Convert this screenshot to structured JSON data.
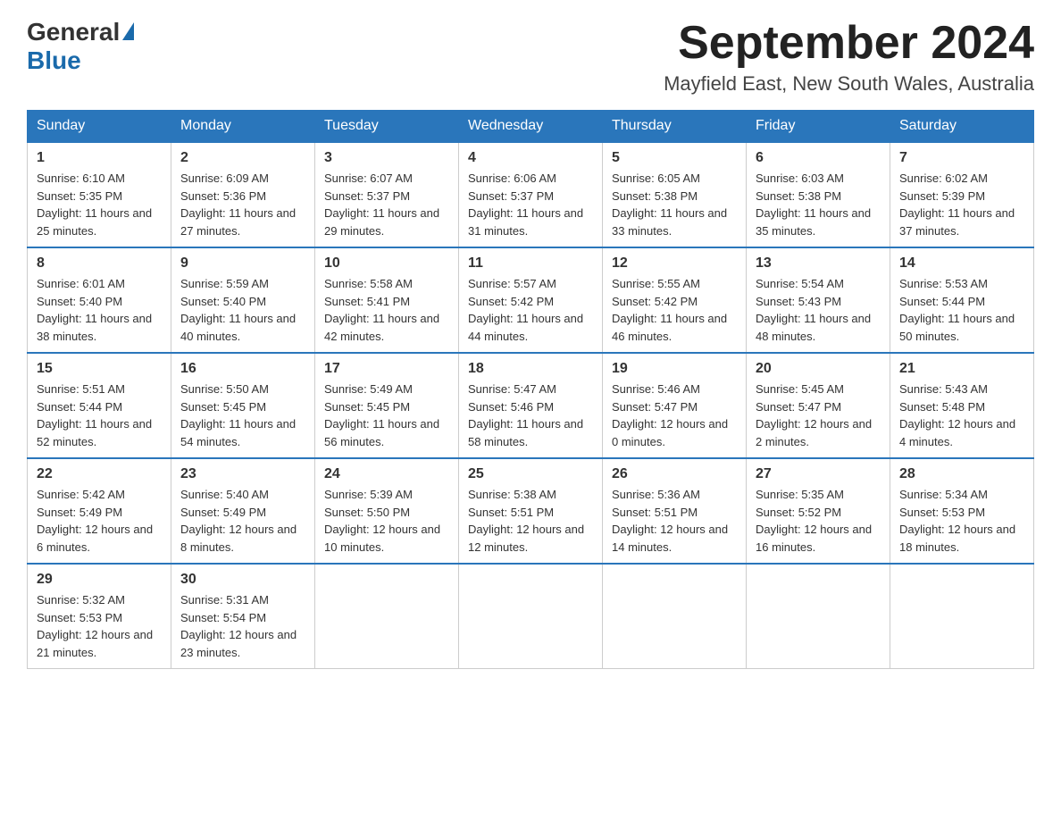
{
  "logo": {
    "text_general": "General",
    "triangle": "▲",
    "text_blue": "Blue"
  },
  "header": {
    "month_title": "September 2024",
    "location": "Mayfield East, New South Wales, Australia"
  },
  "days_of_week": [
    "Sunday",
    "Monday",
    "Tuesday",
    "Wednesday",
    "Thursday",
    "Friday",
    "Saturday"
  ],
  "weeks": [
    [
      {
        "day": "1",
        "sunrise": "6:10 AM",
        "sunset": "5:35 PM",
        "daylight": "11 hours and 25 minutes."
      },
      {
        "day": "2",
        "sunrise": "6:09 AM",
        "sunset": "5:36 PM",
        "daylight": "11 hours and 27 minutes."
      },
      {
        "day": "3",
        "sunrise": "6:07 AM",
        "sunset": "5:37 PM",
        "daylight": "11 hours and 29 minutes."
      },
      {
        "day": "4",
        "sunrise": "6:06 AM",
        "sunset": "5:37 PM",
        "daylight": "11 hours and 31 minutes."
      },
      {
        "day": "5",
        "sunrise": "6:05 AM",
        "sunset": "5:38 PM",
        "daylight": "11 hours and 33 minutes."
      },
      {
        "day": "6",
        "sunrise": "6:03 AM",
        "sunset": "5:38 PM",
        "daylight": "11 hours and 35 minutes."
      },
      {
        "day": "7",
        "sunrise": "6:02 AM",
        "sunset": "5:39 PM",
        "daylight": "11 hours and 37 minutes."
      }
    ],
    [
      {
        "day": "8",
        "sunrise": "6:01 AM",
        "sunset": "5:40 PM",
        "daylight": "11 hours and 38 minutes."
      },
      {
        "day": "9",
        "sunrise": "5:59 AM",
        "sunset": "5:40 PM",
        "daylight": "11 hours and 40 minutes."
      },
      {
        "day": "10",
        "sunrise": "5:58 AM",
        "sunset": "5:41 PM",
        "daylight": "11 hours and 42 minutes."
      },
      {
        "day": "11",
        "sunrise": "5:57 AM",
        "sunset": "5:42 PM",
        "daylight": "11 hours and 44 minutes."
      },
      {
        "day": "12",
        "sunrise": "5:55 AM",
        "sunset": "5:42 PM",
        "daylight": "11 hours and 46 minutes."
      },
      {
        "day": "13",
        "sunrise": "5:54 AM",
        "sunset": "5:43 PM",
        "daylight": "11 hours and 48 minutes."
      },
      {
        "day": "14",
        "sunrise": "5:53 AM",
        "sunset": "5:44 PM",
        "daylight": "11 hours and 50 minutes."
      }
    ],
    [
      {
        "day": "15",
        "sunrise": "5:51 AM",
        "sunset": "5:44 PM",
        "daylight": "11 hours and 52 minutes."
      },
      {
        "day": "16",
        "sunrise": "5:50 AM",
        "sunset": "5:45 PM",
        "daylight": "11 hours and 54 minutes."
      },
      {
        "day": "17",
        "sunrise": "5:49 AM",
        "sunset": "5:45 PM",
        "daylight": "11 hours and 56 minutes."
      },
      {
        "day": "18",
        "sunrise": "5:47 AM",
        "sunset": "5:46 PM",
        "daylight": "11 hours and 58 minutes."
      },
      {
        "day": "19",
        "sunrise": "5:46 AM",
        "sunset": "5:47 PM",
        "daylight": "12 hours and 0 minutes."
      },
      {
        "day": "20",
        "sunrise": "5:45 AM",
        "sunset": "5:47 PM",
        "daylight": "12 hours and 2 minutes."
      },
      {
        "day": "21",
        "sunrise": "5:43 AM",
        "sunset": "5:48 PM",
        "daylight": "12 hours and 4 minutes."
      }
    ],
    [
      {
        "day": "22",
        "sunrise": "5:42 AM",
        "sunset": "5:49 PM",
        "daylight": "12 hours and 6 minutes."
      },
      {
        "day": "23",
        "sunrise": "5:40 AM",
        "sunset": "5:49 PM",
        "daylight": "12 hours and 8 minutes."
      },
      {
        "day": "24",
        "sunrise": "5:39 AM",
        "sunset": "5:50 PM",
        "daylight": "12 hours and 10 minutes."
      },
      {
        "day": "25",
        "sunrise": "5:38 AM",
        "sunset": "5:51 PM",
        "daylight": "12 hours and 12 minutes."
      },
      {
        "day": "26",
        "sunrise": "5:36 AM",
        "sunset": "5:51 PM",
        "daylight": "12 hours and 14 minutes."
      },
      {
        "day": "27",
        "sunrise": "5:35 AM",
        "sunset": "5:52 PM",
        "daylight": "12 hours and 16 minutes."
      },
      {
        "day": "28",
        "sunrise": "5:34 AM",
        "sunset": "5:53 PM",
        "daylight": "12 hours and 18 minutes."
      }
    ],
    [
      {
        "day": "29",
        "sunrise": "5:32 AM",
        "sunset": "5:53 PM",
        "daylight": "12 hours and 21 minutes."
      },
      {
        "day": "30",
        "sunrise": "5:31 AM",
        "sunset": "5:54 PM",
        "daylight": "12 hours and 23 minutes."
      },
      null,
      null,
      null,
      null,
      null
    ]
  ],
  "labels": {
    "sunrise_prefix": "Sunrise: ",
    "sunset_prefix": "Sunset: ",
    "daylight_prefix": "Daylight: "
  }
}
